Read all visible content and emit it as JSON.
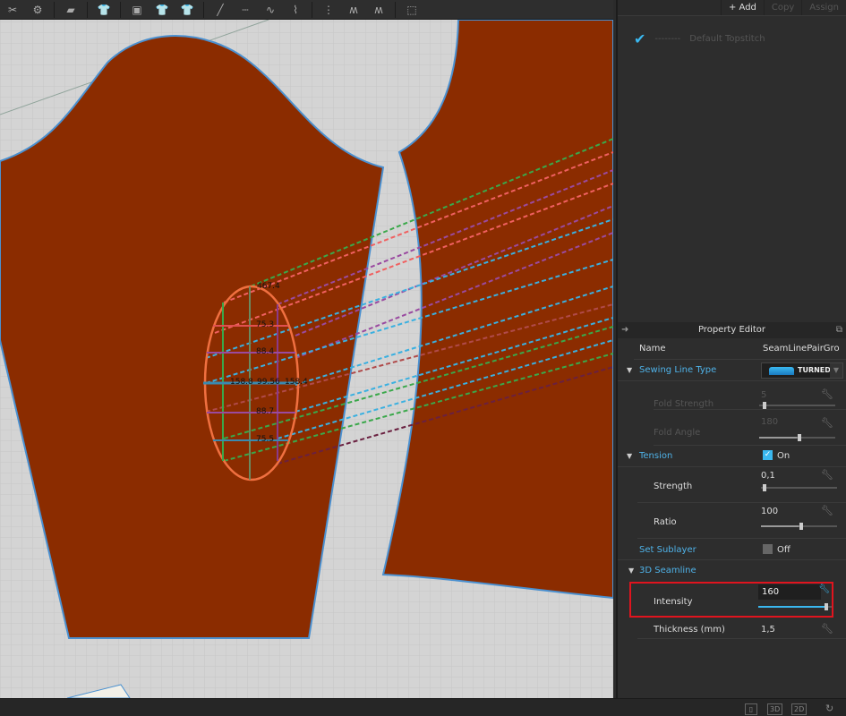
{
  "toolbar": {
    "icons": [
      "pattern-tool-icon",
      "seam-tool-icon",
      "sewing-machine-icon",
      "iron-icon",
      "select-garment-icon",
      "fabric-select-icon",
      "garment-pattern-icon",
      "garment-grid-icon",
      "line-edit-icon",
      "seam-line-icon",
      "curve-seam-icon",
      "sewing-seam-icon",
      "vertical-stitch-icon",
      "topstitch-icon",
      "stitch-pattern-icon",
      "select-area-icon"
    ]
  },
  "canvas": {
    "measurements": [
      "467.4",
      "75.3",
      "88.4",
      "158.8",
      "99.56",
      "158.4",
      "88.7",
      "75.5"
    ],
    "fabric_color": "#8b2c00",
    "outline_color": "#4a90d0"
  },
  "topstitch": {
    "add": "+ Add",
    "copy": "Copy",
    "assign": "Assign",
    "item_line": "--------",
    "item_name": "Default Topstitch"
  },
  "property_editor": {
    "title": "Property Editor",
    "name_label": "Name",
    "name_value": "SeamLinePairGro",
    "sewing_line_type": "Sewing Line Type",
    "sewing_line_value": "TURNED",
    "fold_strength": "Fold Strength",
    "fold_strength_value": "5",
    "fold_strength_fraction": 0.05,
    "fold_angle": "Fold Angle",
    "fold_angle_value": "180",
    "fold_angle_fraction": 0.5,
    "tension": "Tension",
    "tension_state": "On",
    "strength": "Strength",
    "strength_value": "0,1",
    "strength_fraction": 0.02,
    "ratio": "Ratio",
    "ratio_value": "100",
    "ratio_fraction": 0.5,
    "set_sublayer": "Set Sublayer",
    "sublayer_state": "Off",
    "seamline_3d": "3D Seamline",
    "intensity": "Intensity",
    "intensity_value": "160",
    "intensity_fraction": 0.9,
    "thickness": "Thickness (mm)",
    "thickness_value": "1,5"
  },
  "statusbar": {
    "btn_3d": "3D",
    "btn_2d": "2D"
  }
}
